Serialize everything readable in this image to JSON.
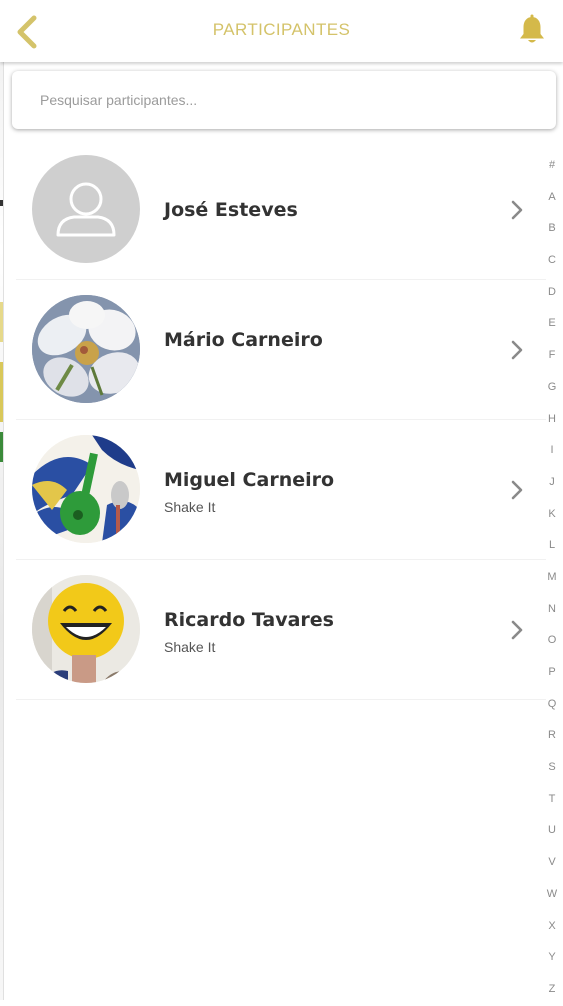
{
  "header": {
    "title": "PARTICIPANTES",
    "back_icon": "chevron-left-icon",
    "bell_icon": "bell-icon",
    "accent_color": "#d4c36a"
  },
  "search": {
    "placeholder": "Pesquisar participantes...",
    "value": ""
  },
  "participants": [
    {
      "name": "José Esteves",
      "subtitle": "",
      "avatar": "default-user-avatar"
    },
    {
      "name": "Mário Carneiro",
      "subtitle": "",
      "avatar": "flower-photo-avatar"
    },
    {
      "name": "Miguel Carneiro",
      "subtitle": "Shake It",
      "avatar": "guitar-artwork-avatar"
    },
    {
      "name": "Ricardo Tavares",
      "subtitle": "Shake It",
      "avatar": "smiley-balloon-avatar"
    }
  ],
  "alphabet": [
    "#",
    "A",
    "B",
    "C",
    "D",
    "E",
    "F",
    "G",
    "H",
    "I",
    "J",
    "K",
    "L",
    "M",
    "N",
    "O",
    "P",
    "Q",
    "R",
    "S",
    "T",
    "U",
    "V",
    "W",
    "X",
    "Y",
    "Z"
  ]
}
